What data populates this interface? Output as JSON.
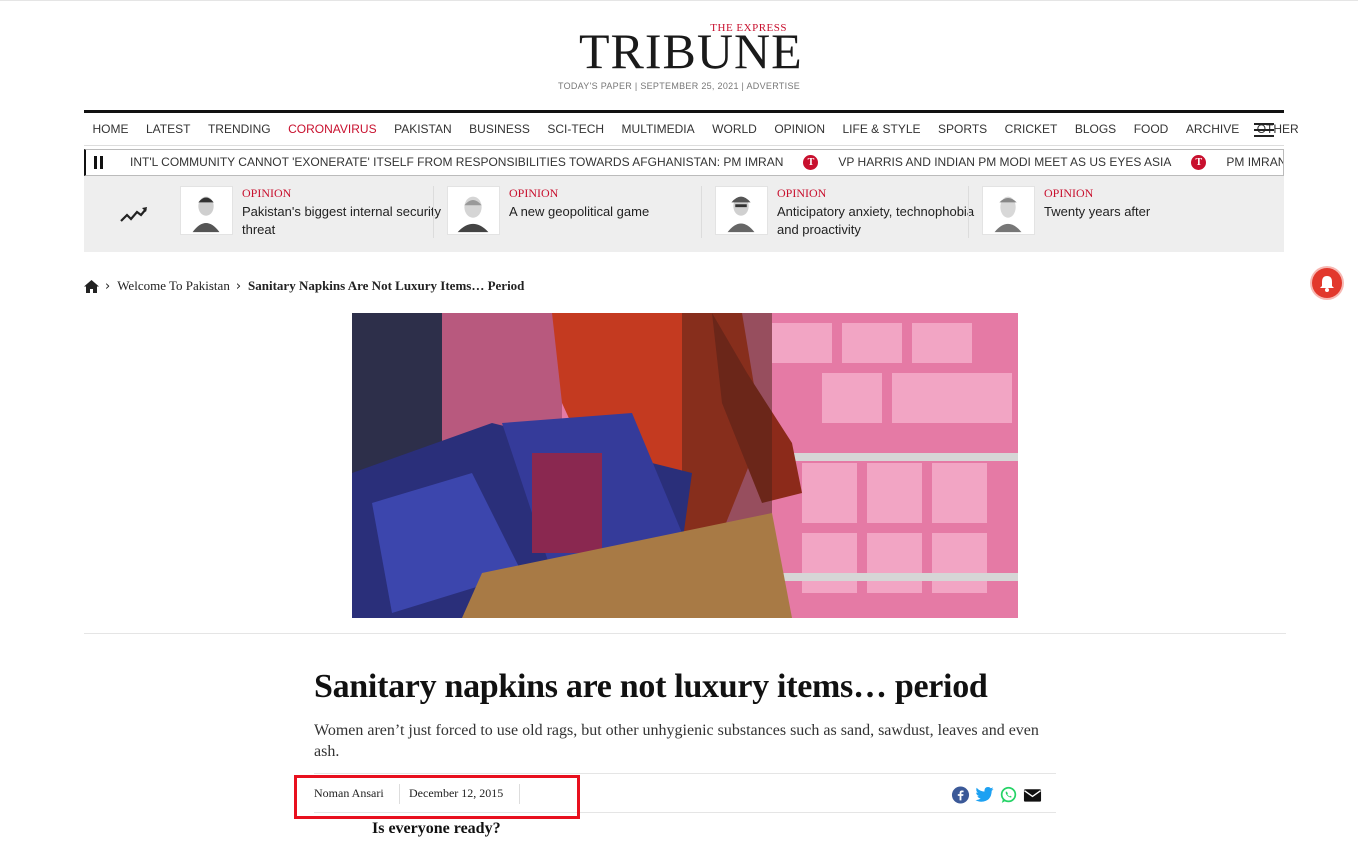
{
  "masthead": {
    "logo_top": "THE EXPRESS",
    "logo_main": "TRIBUNE",
    "dateline": "TODAY'S PAPER | SEPTEMBER 25, 2021 | ADVERTISE"
  },
  "nav": {
    "items": [
      "HOME",
      "LATEST",
      "TRENDING",
      "CORONAVIRUS",
      "PAKISTAN",
      "BUSINESS",
      "SCI-TECH",
      "MULTIMEDIA",
      "WORLD",
      "OPINION",
      "LIFE & STYLE",
      "SPORTS",
      "CRICKET",
      "BLOGS",
      "FOOD",
      "ARCHIVE",
      "OTHER"
    ],
    "highlighted": "CORONAVIRUS",
    "menu_icon": "hamburger-icon"
  },
  "ticker": {
    "items": [
      "INT'L COMMUNITY CANNOT 'EXONERATE' ITSELF FROM RESPONSIBILITIES TOWARDS AFGHANISTAN: PM IMRAN",
      "VP HARRIS AND INDIAN PM MODI MEET AS US EYES ASIA",
      "PM IMRAN TO"
    ],
    "separator_glyph": "T"
  },
  "opinion_strip": {
    "cards": [
      {
        "label": "OPINION",
        "title": "Pakistan's biggest internal security threat"
      },
      {
        "label": "OPINION",
        "title": "A new geopolitical game"
      },
      {
        "label": "OPINION",
        "title": "Anticipatory anxiety, technophobia and proactivity"
      },
      {
        "label": "OPINION",
        "title": "Twenty years after"
      }
    ]
  },
  "breadcrumb": {
    "section": "Welcome To Pakistan",
    "current": "Sanitary Napkins Are Not Luxury Items… Period"
  },
  "article": {
    "headline": "Sanitary napkins are not luxury items… period",
    "standfirst": "Women aren’t just forced to use old rags, but other unhygienic substances such as sand, sawdust, leaves and even ash.",
    "author": "Noman Ansari",
    "date": "December 12, 2015",
    "subheading": "Is everyone ready?"
  },
  "share": [
    "facebook-icon",
    "twitter-icon",
    "whatsapp-icon",
    "email-icon"
  ],
  "colors": {
    "brand_red": "#c8102e",
    "highlight_box": "#e8101e"
  }
}
